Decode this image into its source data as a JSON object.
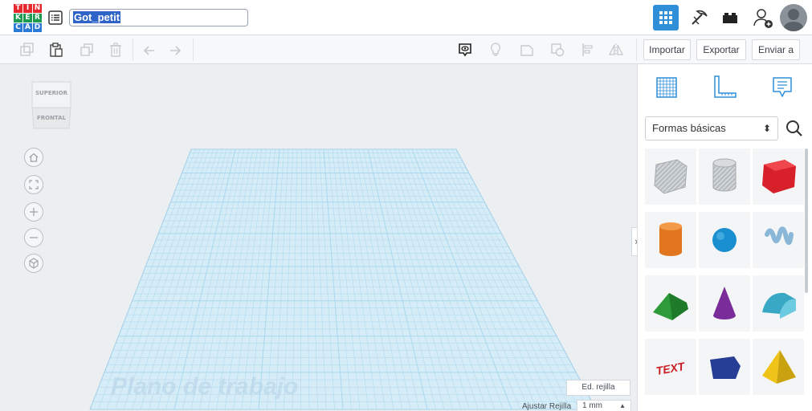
{
  "app": {
    "logo_letters": [
      "T",
      "I",
      "N",
      "K",
      "E",
      "R",
      "C",
      "A",
      "D"
    ],
    "logo_colors": [
      "#e6282e",
      "#e6282e",
      "#e6282e",
      "#1d9a51",
      "#1d9a51",
      "#1d9a51",
      "#2d7ad6",
      "#2d7ad6",
      "#2d7ad6"
    ]
  },
  "header": {
    "design_title": "Got_petit",
    "accent": "#2f8fd8"
  },
  "toolbar": {
    "import_label": "Importar",
    "export_label": "Exportar",
    "send_label": "Enviar a"
  },
  "viewcube": {
    "top_label": "SUPERIOR",
    "front_label": "FRONTAL"
  },
  "workplane": {
    "label": "Plano de trabajo",
    "edit_grid_label": "Ed. rejilla",
    "snap_grid_label": "Ajustar Rejilla",
    "snap_grid_value": "1 mm",
    "grid_color": "#a9d8ef"
  },
  "panel": {
    "category": "Formas básicas",
    "shapes": [
      {
        "name": "box-hole",
        "color": "#b9bec3"
      },
      {
        "name": "cylinder-hole",
        "color": "#b9bec3"
      },
      {
        "name": "box",
        "color": "#d8202a"
      },
      {
        "name": "cylinder",
        "color": "#e2761f"
      },
      {
        "name": "sphere",
        "color": "#1a8fcf"
      },
      {
        "name": "scribble",
        "color": "#8ab7d8"
      },
      {
        "name": "roof",
        "color": "#2e9a3a"
      },
      {
        "name": "cone",
        "color": "#7a2d9a"
      },
      {
        "name": "round-roof",
        "color": "#38a8c4"
      },
      {
        "name": "text",
        "color": "#c91f25"
      },
      {
        "name": "polygon",
        "color": "#263e95"
      },
      {
        "name": "pyramid",
        "color": "#efc317"
      }
    ],
    "text_shape_label": "TEXT"
  }
}
